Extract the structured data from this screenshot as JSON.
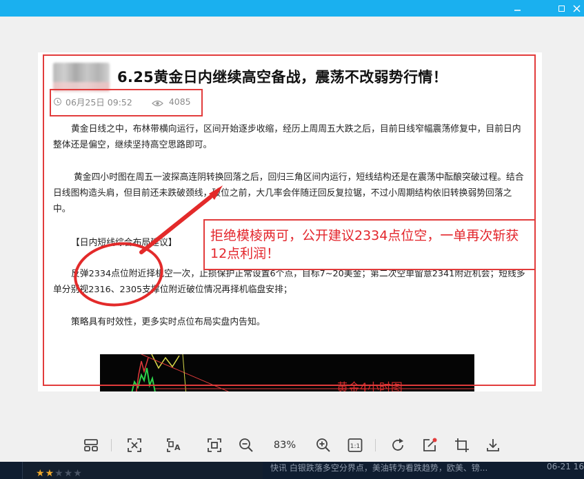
{
  "window": {
    "minimize_icon": "minimize-icon",
    "maximize_icon": "maximize-icon",
    "close_icon": "close-icon",
    "accent_color": "#1ab0ef"
  },
  "article": {
    "title": "6.25黄金日内继续高空备战，震荡不改弱势行情！",
    "date": "06月25日 09:52",
    "views": "4085",
    "paragraphs": [
      "黄金日线之中，布林带横向运行，区间开始逐步收缩，经历上周周五大跌之后，目前日线窄幅震荡修复中，目前日内整体还是偏空，继续坚持高空思路即可。",
      "黄金四小时图在周五一波探高连阴转换回落之后，回归三角区间内运行，短线结构还是在震荡中酝酿突破过程。结合日线图构造头肩，但目前还未跌破颈线，破位之前，大几率会伴随迂回反复拉锯，不过小周期结构依旧转换弱势回落之中。",
      "【日内短线综合布局建议】",
      "反弹2334点位附近择机空一次，止损保护正常设置6个点，目标7~20美金；第二次空单留意2341附近机会；短线多单分别视2316、2305支撑位附近破位情况再择机临盘安排；",
      "策略具有时效性，更多实时点位布局实盘内告知。"
    ],
    "annotation": "拒绝模棱两可，公开建议2334点位空，一单再次斩获12点利润！",
    "chart_caption": "黄金4小时图",
    "highlight_color": "#e23b3b"
  },
  "toolbar": {
    "zoom": "83%",
    "items": [
      {
        "name": "thumbnails-icon"
      },
      {
        "name": "fit-window-icon"
      },
      {
        "name": "ocr-text-icon"
      },
      {
        "name": "original-size-icon"
      },
      {
        "name": "zoom-out-icon"
      },
      {
        "name": "zoom-in-icon"
      },
      {
        "name": "actual-size-icon"
      },
      {
        "name": "rotate-icon"
      },
      {
        "name": "edit-icon"
      },
      {
        "name": "crop-icon"
      },
      {
        "name": "download-icon"
      }
    ],
    "one_to_one": "1:1"
  },
  "bottom_bar": {
    "rating": 2,
    "rating_max": 5,
    "ticker": "快讯  白银跌落多空分界点，美油转为看跌趋势，欧美、镑...",
    "ticker_date": "06-21 16:"
  }
}
